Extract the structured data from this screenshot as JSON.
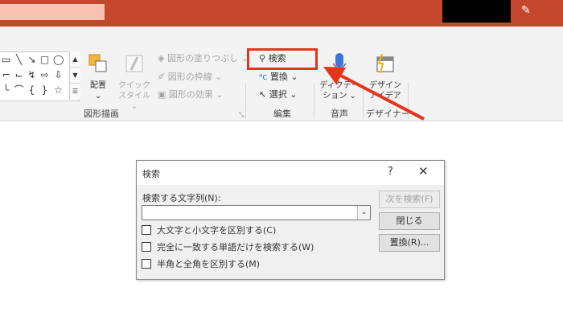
{
  "colors": {
    "titlebar": "#c5472e",
    "highlight": "#e8331c",
    "arrow": "#e8331c",
    "ribbon_bg": "#f3f3f3",
    "dialog_bg": "#f0f0f0"
  },
  "icons": {
    "shapes": [
      "textbox-icon",
      "line-icon",
      "diagonal-line-icon",
      "rectangle-icon",
      "oval-icon",
      "elbow-connector-icon",
      "curved-connector-icon",
      "right-arrow-icon",
      "down-arrow-icon",
      "brace-icon",
      "curve-icon",
      "bracket-icon",
      "quote-icon",
      "pen-icon"
    ],
    "arrange": "arrange-icon",
    "quick_styles": "quick-styles-icon",
    "search": "magnifier-icon",
    "replace": "replace-icon",
    "select": "select-cursor-icon",
    "dictation": "microphone-icon",
    "design_ideas": "design-ideas-icon"
  },
  "ribbon": {
    "arrange": {
      "label": "配置",
      "caret": "⌄"
    },
    "quick_styles": {
      "line1": "クイック",
      "line2": "スタイル",
      "caret": "⌄"
    },
    "shape_fill": "図形の塗りつぶし",
    "shape_outline": "図形の枠線",
    "shape_effects": "図形の効果",
    "caret": "⌄",
    "drawing_group": "図形描画",
    "search": "検索",
    "replace": "置換",
    "select": "選択",
    "edit_group": "編集",
    "dictation": {
      "line1": "ディクテー",
      "line2": "ション",
      "caret": "⌄"
    },
    "voice_group": "音声",
    "design_ideas": {
      "line1": "デザイン",
      "line2": "アイデア"
    },
    "designer_group": "デザイナー"
  },
  "dialog": {
    "title": "検索",
    "help": "?",
    "close": "✕",
    "find_label": "検索する文字列(N):",
    "find_value": "",
    "dropdown_caret": "⌄",
    "options": [
      {
        "label": "大文字と小文字を区別する(C)",
        "checked": false
      },
      {
        "label": "完全に一致する単語だけを検索する(W)",
        "checked": false
      },
      {
        "label": "半角と全角を区別する(M)",
        "checked": false
      }
    ],
    "buttons": {
      "find_next": "次を検索(F)",
      "close": "閉じる",
      "replace": "置換(R)..."
    }
  }
}
